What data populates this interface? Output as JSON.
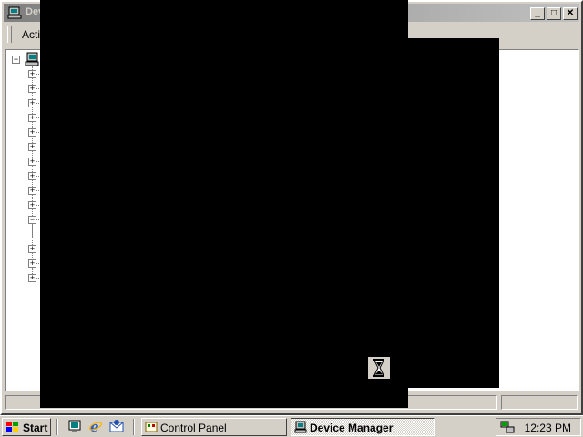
{
  "window": {
    "title": "Device Manager",
    "visible_title_fragment": "Dev",
    "buttons": {
      "minimize": "_",
      "maximize": "□",
      "close": "✕"
    }
  },
  "toolbar": {
    "action_menu_fragment": "Actio"
  },
  "tree": {
    "root": {
      "expanded": true
    },
    "nodes": [
      {
        "state": "collapsed"
      },
      {
        "state": "collapsed"
      },
      {
        "state": "collapsed"
      },
      {
        "state": "collapsed"
      },
      {
        "state": "collapsed"
      },
      {
        "state": "collapsed"
      },
      {
        "state": "collapsed"
      },
      {
        "state": "collapsed"
      },
      {
        "state": "collapsed"
      },
      {
        "state": "collapsed"
      },
      {
        "state": "expanded"
      },
      {
        "state": "collapsed"
      },
      {
        "state": "collapsed"
      },
      {
        "state": "collapsed"
      }
    ]
  },
  "taskbar": {
    "start_label": "Start",
    "quick_launch": [
      "desktop-icon",
      "internet-explorer-icon",
      "outlook-express-icon"
    ],
    "tasks": [
      {
        "label": "Control Panel",
        "active": false
      },
      {
        "label": "Device Manager",
        "active": true
      }
    ],
    "clock": "12:23 PM"
  },
  "colors": {
    "title_active": "#0a246a",
    "face": "#d4d0c8",
    "shadow": "#808080",
    "highlight": "#ffffff"
  }
}
